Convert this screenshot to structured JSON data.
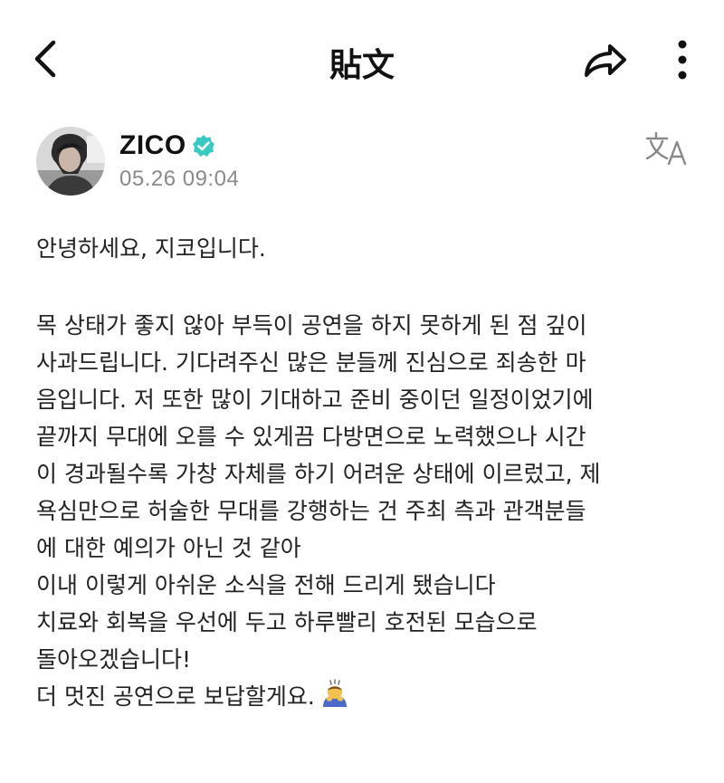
{
  "header": {
    "title": "貼文",
    "back_icon": "chevron-left-icon",
    "share_icon": "share-arrow-icon",
    "more_icon": "vertical-dots-icon"
  },
  "post": {
    "author_name": "ZICO",
    "verified_color": "#38c9c2",
    "timestamp": "05.26 09:04",
    "translate_icon": "translate-icon",
    "greeting": "안녕하세요, 지코입니다.",
    "lines": [
      "목 상태가 좋지 않아 부득이 공연을 하지 못하게 된 점 깊이",
      "사과드립니다. 기다려주신 많은 분들께 진심으로 죄송한 마",
      "음입니다. 저 또한 많이 기대하고 준비 중이던 일정이었기에",
      "끝까지 무대에 오를 수 있게끔 다방면으로 노력했으나 시간",
      "이 경과될수록 가창 자체를 하기 어려운 상태에 이르렀고, 제",
      "욕심만으로 허술한 무대를 강행하는 건 주최 측과 관객분들",
      "에 대한 예의가 아닌 것 같아",
      "이내 이렇게 아쉬운 소식을 전해 드리게 됐습니다",
      "치료와 회복을 우선에 두고 하루빨리 호전된 모습으로",
      "돌아오겠습니다!",
      "더 멋진 공연으로 보답할게요."
    ],
    "emoji_icon": "bowing-person-icon"
  }
}
